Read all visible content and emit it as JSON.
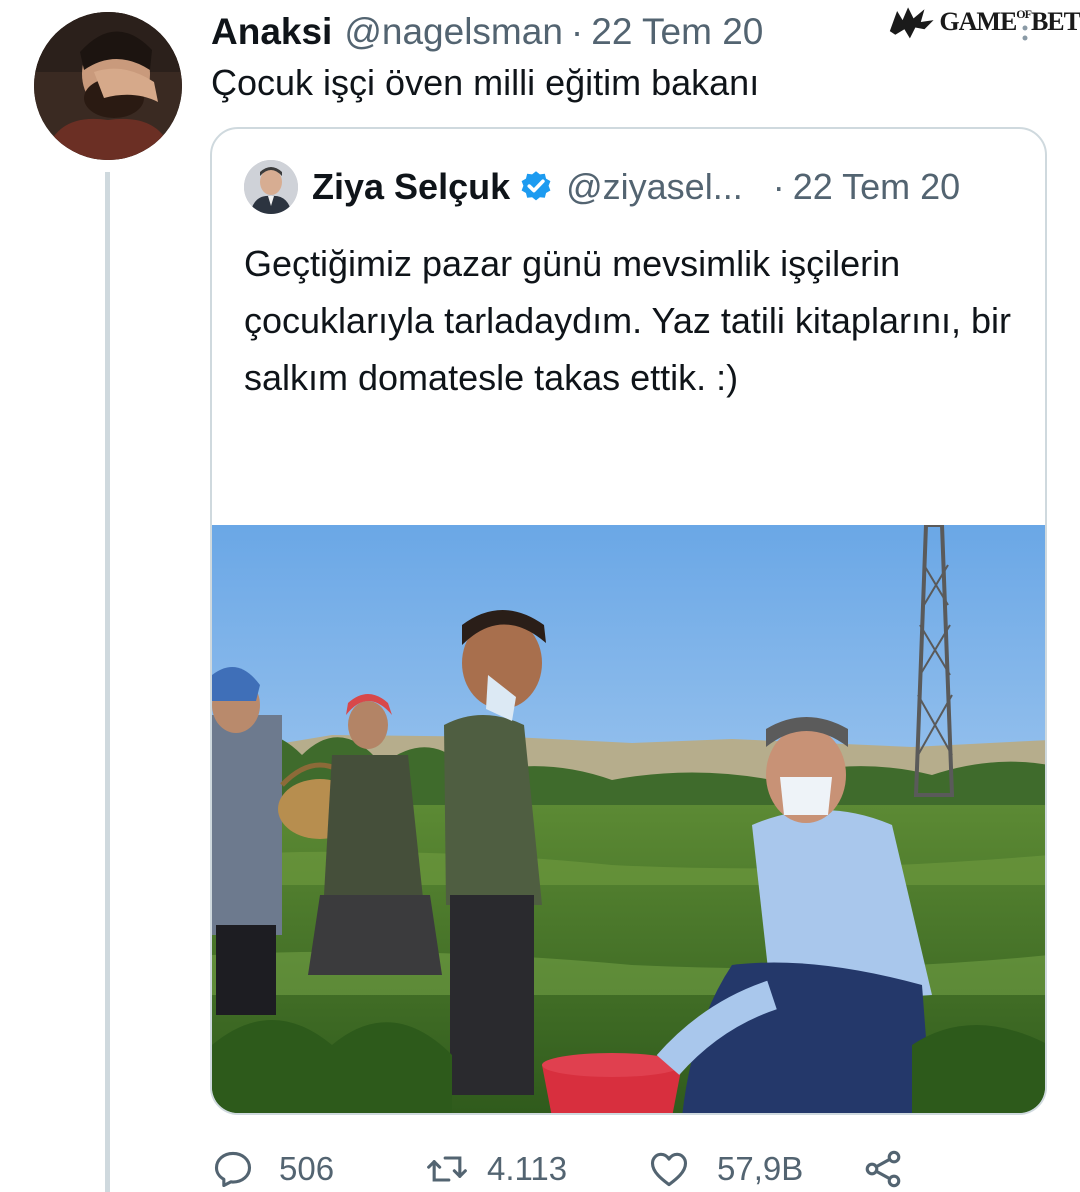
{
  "tweet": {
    "display_name": "Anaksi",
    "handle": "@nagelsman",
    "separator": "·",
    "time": "22 Tem 20",
    "text": "Çocuk işçi öven milli eğitim bakanı"
  },
  "quoted_tweet": {
    "display_name": "Ziya Selçuk",
    "handle": "@ziyasel...",
    "separator": "·",
    "time": "22 Tem 20",
    "text": "Geçtiğimiz pazar günü mevsimlik işçilerin çocuklarıyla tarladaydım. Yaz tatili kitaplarını, bir salkım domatesle takas ettik. :)",
    "ellipsis": "...",
    "verified_icon": "verified-badge-icon"
  },
  "actions": {
    "reply_count": "506",
    "retweet_count": "4.113",
    "like_count": "57,9B",
    "icons": [
      "reply-icon",
      "retweet-icon",
      "like-icon",
      "share-icon"
    ]
  },
  "watermark": {
    "text": "GAME",
    "small": "OF",
    "text2": "BET"
  },
  "colors": {
    "text_primary": "#0f1419",
    "text_secondary": "#536471",
    "border": "#cfd9de",
    "verified_blue": "#1d9bf0"
  }
}
